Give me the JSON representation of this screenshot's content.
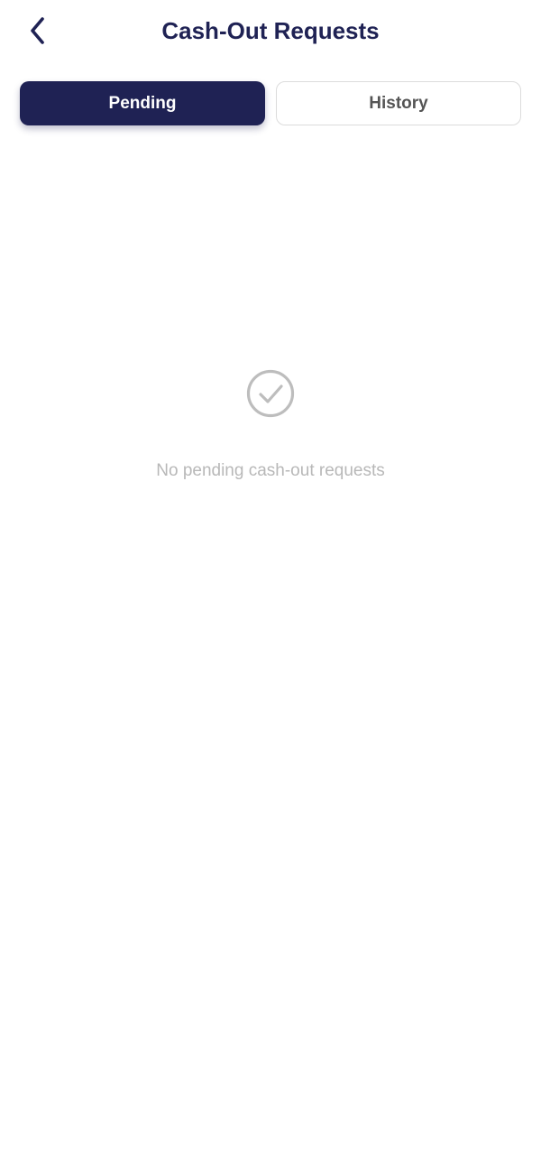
{
  "header": {
    "title": "Cash-Out Requests",
    "back_icon": "chevron-left-icon"
  },
  "tabs": [
    {
      "label": "Pending",
      "active": true
    },
    {
      "label": "History",
      "active": false
    }
  ],
  "empty_state": {
    "icon": "check-circle-icon",
    "message": "No pending cash-out requests"
  },
  "colors": {
    "primary": "#1f2254",
    "title": "#1f2254",
    "tab_inactive_text": "#555555",
    "tab_inactive_border": "#dcdcdc",
    "empty_icon": "#bdbdbd",
    "empty_text": "#b8b8b8",
    "background": "#ffffff"
  }
}
